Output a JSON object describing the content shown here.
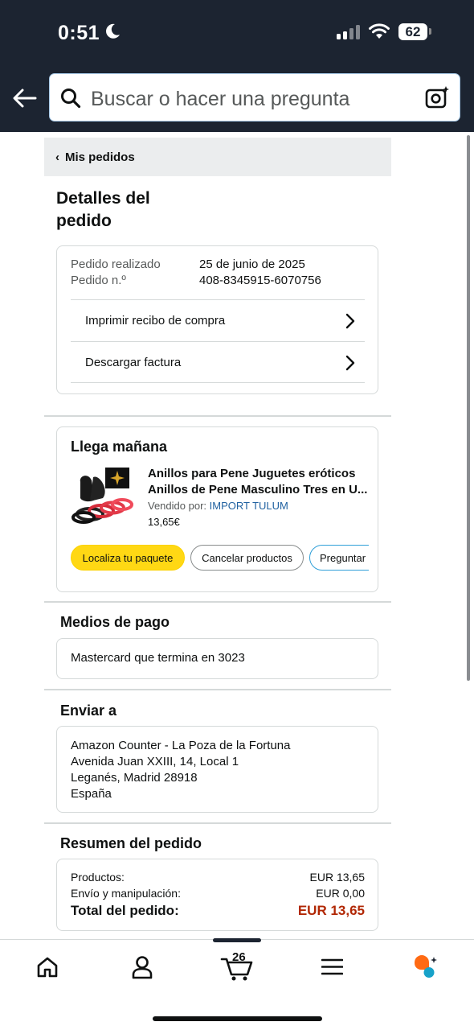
{
  "status_bar": {
    "time": "0:51",
    "battery": "62"
  },
  "search": {
    "placeholder": "Buscar o hacer una pregunta"
  },
  "breadcrumb": {
    "label": "Mis pedidos"
  },
  "page_title": "Detalles del pedido",
  "order_info": {
    "placed_label": "Pedido realizado",
    "placed_value": "25 de junio de 2025",
    "number_label": "Pedido n.º",
    "number_value": "408-8345915-6070756",
    "links": [
      "Imprimir recibo de compra",
      "Descargar factura"
    ]
  },
  "shipment": {
    "title": "Llega mañana",
    "product_title_line1": "Anillos para Pene Juguetes eróticos",
    "product_title_line2": "Anillos de Pene Masculino Tres en U...",
    "sold_by_label": "Vendido por:",
    "seller": "IMPORT TULUM",
    "price": "13,65€",
    "buttons": [
      "Localiza tu paquete",
      "Cancelar productos",
      "Preguntar"
    ]
  },
  "payment": {
    "title": "Medios de pago",
    "method": "Mastercard  que termina en 3023"
  },
  "shipping": {
    "title": "Enviar a",
    "lines": [
      "Amazon Counter - La Poza de la Fortuna",
      "Avenida Juan XXIII, 14, Local 1",
      "Leganés, Madrid 28918",
      "España"
    ]
  },
  "summary": {
    "title": "Resumen del pedido",
    "products_label": "Productos:",
    "products_value": "EUR 13,65",
    "shipping_label": "Envío y manipulación:",
    "shipping_value": "EUR 0,00",
    "total_label": "Total del pedido:",
    "total_value": "EUR 13,65"
  },
  "bottom_nav": {
    "cart_count": "26"
  },
  "colors": {
    "header": "#1c2431",
    "button_yellow": "#ffd814",
    "link_blue": "#2162a1",
    "price_red": "#b12704"
  }
}
